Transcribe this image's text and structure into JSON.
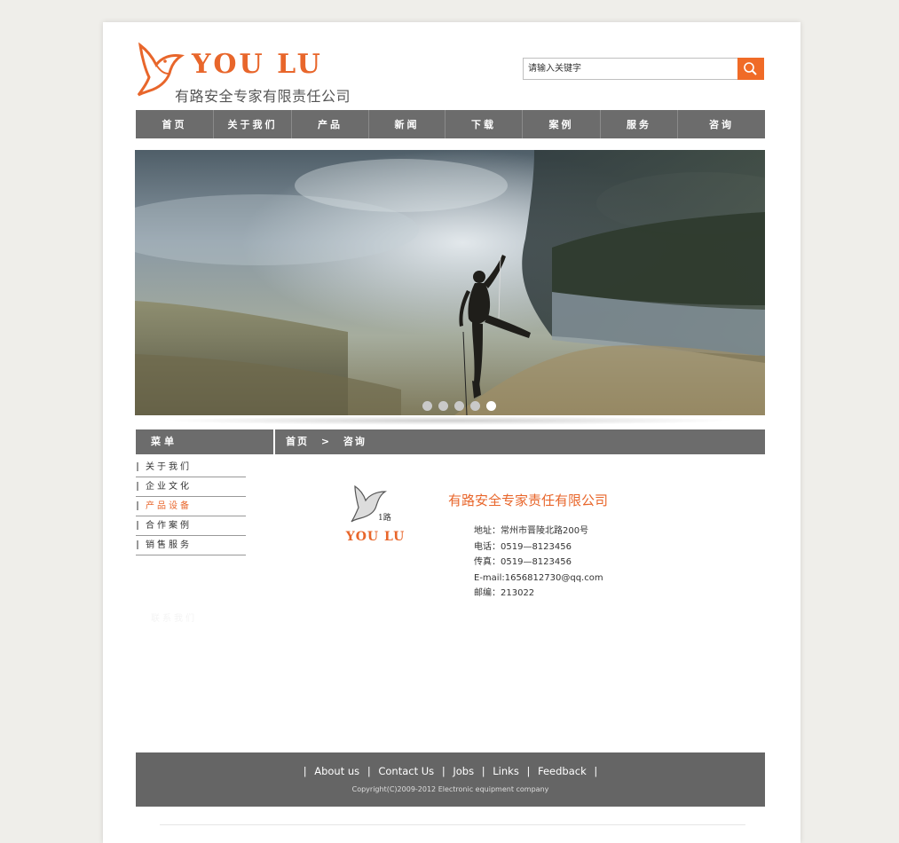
{
  "header": {
    "brand_en": "YOU LU",
    "brand_cn": "有路安全专家有限责任公司",
    "search_placeholder": "请输入关键字"
  },
  "nav": [
    "首页",
    "关于我们",
    "产品",
    "新闻",
    "下载",
    "案例",
    "服务",
    "咨询"
  ],
  "banner": {
    "slides": 5,
    "active_slide": 5
  },
  "sidebar": {
    "title": "菜单",
    "items": [
      "关于我们",
      "企业文化",
      "产品设备",
      "合作案例",
      "销售服务"
    ],
    "active_index": 2,
    "faint_text": "联系我们"
  },
  "breadcrumb": {
    "home": "首页",
    "sep": ">",
    "current": "咨询"
  },
  "contact": {
    "logo_text": "YOU LU",
    "company": "有路安全专家责任有限公司",
    "address": "地址：常州市晋陵北路200号",
    "phone": "电话：0519—8123456",
    "fax": "传真：0519—8123456",
    "email": "E-mail:1656812730@qq.com",
    "postcode": "邮编：213022"
  },
  "footer": {
    "links": [
      "About us",
      "Contact Us",
      "Jobs",
      "Links",
      "Feedback"
    ],
    "sep": "|",
    "copyright": "Copyright(C)2009-2012 Electronic equipment company"
  },
  "colors": {
    "accent": "#e8662b",
    "bar": "#6c6c6c",
    "footer": "#656565"
  }
}
